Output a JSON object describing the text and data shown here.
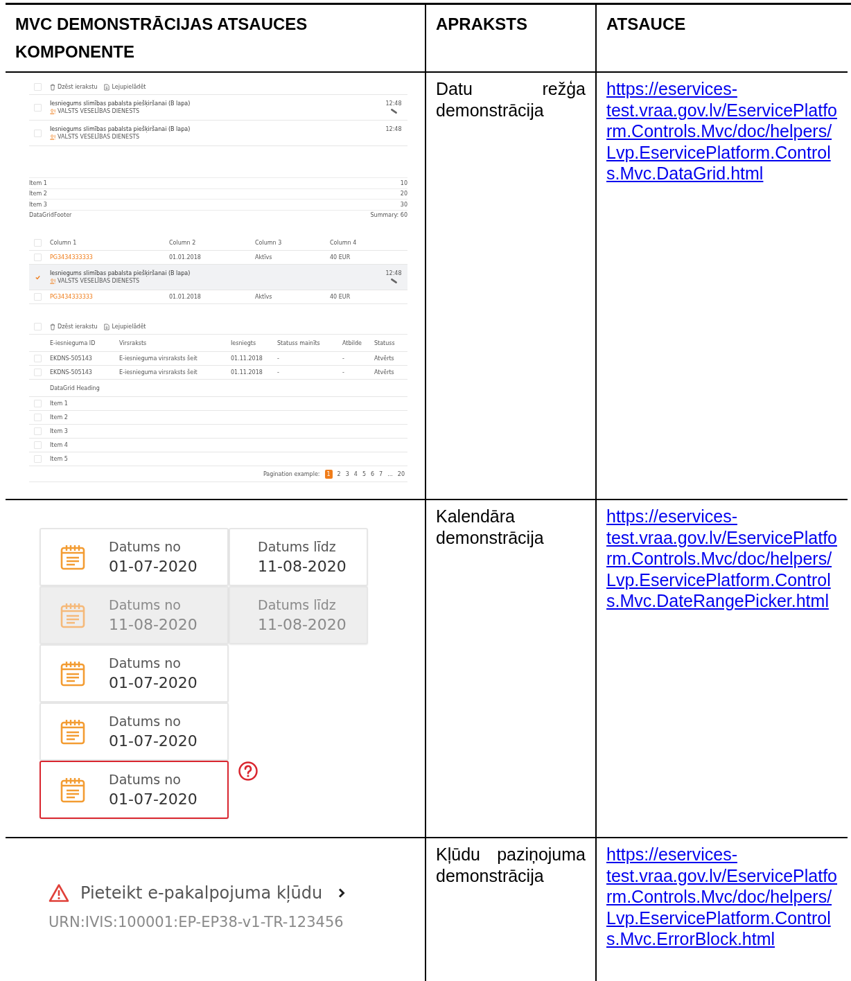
{
  "table": {
    "columns": [
      "MVC DEMONSTRĀCIJAS ATSAUCES KOMPONENTE",
      "APRAKSTS",
      "ATSAUCE"
    ],
    "rows": [
      {
        "kind": "datagrid",
        "description": "Datu režģa demonstrācija",
        "link": "https://eservices-test.vraa.gov.lv/EservicePlatform.Controls.Mvc/doc/helpers/Lvp.EservicePlatform.Controls.Mvc.DataGrid.html",
        "datagrid": {
          "message_list": {
            "toolbar": {
              "delete": "Dzēst ierakstu",
              "download": "Lejupielādēt",
              "selected": false
            },
            "messages": [
              {
                "title": "Iesniegums slimības pabalsta piešķiršanai (B lapa)",
                "sender": "VALSTS VESELĪBAS DIENESTS",
                "time": "12:48",
                "attachment": true,
                "selected": false
              },
              {
                "title": "Iesniegums slimības pabalsta piešķiršanai (B lapa)",
                "sender": "VALSTS VESELĪBAS DIENESTS",
                "time": "12:48",
                "attachment": false,
                "selected": false
              }
            ]
          },
          "summary_list": {
            "items": [
              {
                "label": "Item 1",
                "value": "10"
              },
              {
                "label": "Item 2",
                "value": "20"
              },
              {
                "label": "Item 3",
                "value": "30"
              }
            ],
            "footer": {
              "label": "DataGridFooter",
              "value": "Summary: 60"
            }
          },
          "mixed_grid": {
            "header_selected": false,
            "columns": [
              "Column 1",
              "Column 2",
              "Column 3",
              "Column 4"
            ],
            "rows": [
              {
                "kind": "data",
                "selected": false,
                "cells": [
                  "PG3434333333",
                  "01.01.2018",
                  "Aktīvs",
                  "40 EUR"
                ]
              },
              {
                "kind": "message",
                "selected": true,
                "title": "Iesniegums slimības pabalsta piešķiršanai (B lapa)",
                "sender": "VALSTS VESELĪBAS DIENESTS",
                "time": "12:48",
                "attachment": true
              },
              {
                "kind": "data",
                "selected": false,
                "cells": [
                  "PG3434333333",
                  "01.01.2018",
                  "Aktīvs",
                  "40 EUR"
                ]
              }
            ]
          },
          "submissions_grid": {
            "toolbar": {
              "delete": "Dzēst ierakstu",
              "download": "Lejupielādēt",
              "selected": false
            },
            "columns": [
              "E-iesnieguma ID",
              "Virsraksts",
              "Iesniegts",
              "Statuss mainīts",
              "Atbilde",
              "Statuss"
            ],
            "rows": [
              {
                "selected": false,
                "cells": [
                  "EKDNS-505143",
                  "E-iesnieguma virsraksts šeit",
                  "01.11.2018",
                  "-",
                  "-",
                  "Atvērts"
                ]
              },
              {
                "selected": false,
                "cells": [
                  "EKDNS-505143",
                  "E-iesnieguma virsraksts šeit",
                  "01.11.2018",
                  "-",
                  "-",
                  "Atvērts"
                ]
              }
            ],
            "heading": "DataGrid Heading",
            "items": [
              {
                "label": "Item 1",
                "selected": false
              },
              {
                "label": "Item 2",
                "selected": false
              },
              {
                "label": "Item 3",
                "selected": false
              },
              {
                "label": "Item 4",
                "selected": false
              },
              {
                "label": "Item 5",
                "selected": false
              }
            ],
            "pagination": {
              "label": "Pagination example:",
              "pages": [
                {
                  "label": "1",
                  "selected": true
                },
                {
                  "label": "2",
                  "selected": false
                },
                {
                  "label": "3",
                  "selected": false
                },
                {
                  "label": "4",
                  "selected": false
                },
                {
                  "label": "5",
                  "selected": false
                },
                {
                  "label": "6",
                  "selected": false
                },
                {
                  "label": "7",
                  "selected": false
                },
                {
                  "label": "...",
                  "selected": false
                },
                {
                  "label": "20",
                  "selected": false
                }
              ]
            }
          }
        }
      },
      {
        "kind": "daterange",
        "description": "Kalendāra demonstrācija",
        "link": "https://eservices-test.vraa.gov.lv/EservicePlatform.Controls.Mvc/doc/helpers/Lvp.EservicePlatform.Controls.Mvc.DateRangePicker.html",
        "pickers": [
          {
            "disabled": false,
            "error": false,
            "fields": [
              {
                "label": "Datums no",
                "value": "01-07-2020"
              },
              {
                "label": "Datums līdz",
                "value": "11-08-2020"
              }
            ]
          },
          {
            "disabled": true,
            "error": false,
            "fields": [
              {
                "label": "Datums no",
                "value": "11-08-2020"
              },
              {
                "label": "Datums līdz",
                "value": "11-08-2020"
              }
            ]
          },
          {
            "disabled": false,
            "error": false,
            "fields": [
              {
                "label": "Datums no",
                "value": "01-07-2020"
              }
            ]
          },
          {
            "disabled": false,
            "error": false,
            "fields": [
              {
                "label": "Datums no",
                "value": "01-07-2020"
              }
            ]
          },
          {
            "disabled": false,
            "error": true,
            "fields": [
              {
                "label": "Datums no",
                "value": "01-07-2020"
              }
            ]
          }
        ]
      },
      {
        "kind": "error",
        "description": "Kļūdu paziņojuma demonstrācija",
        "link": "https://eservices-test.vraa.gov.lv/EservicePlatform.Controls.Mvc/doc/helpers/Lvp.EservicePlatform.Controls.Mvc.ErrorBlock.html",
        "error_block": {
          "title": "Pieteikt e-pakalpojuma kļūdu",
          "code": "URN:IVIS:100001:EP-EP38-v1-TR-123456"
        }
      }
    ]
  }
}
